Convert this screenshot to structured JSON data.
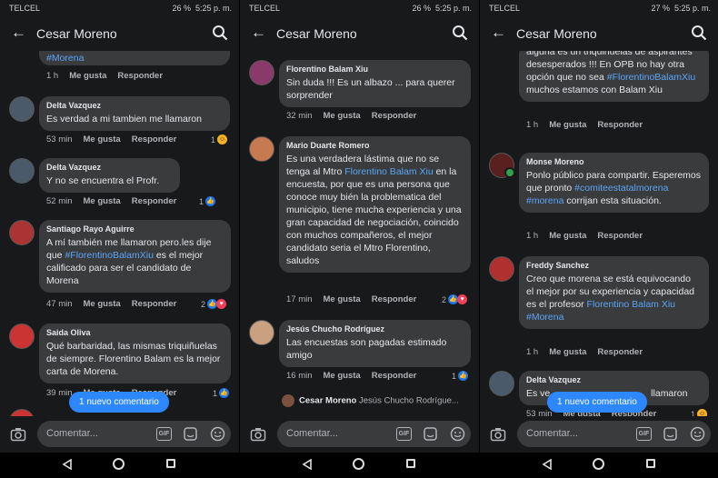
{
  "status_bar": [
    {
      "carrier": "TELCEL",
      "signal": "4G",
      "battery": "26 %",
      "time": "5:25 p. m."
    },
    {
      "carrier": "TELCEL",
      "signal": "4G",
      "battery": "26 %",
      "time": "5:25 p. m."
    },
    {
      "carrier": "TELCEL",
      "signal": "4G",
      "battery": "27 %",
      "time": "5:25 p. m."
    }
  ],
  "header": {
    "title": "Cesar Moreno",
    "back_icon": "arrow-left-icon",
    "search_icon": "search-icon"
  },
  "actions": {
    "like": "Me gusta",
    "reply": "Responder"
  },
  "panels": [
    {
      "comments": [
        {
          "author": "",
          "text": "",
          "link": "#Morena",
          "time": "1 h",
          "reactions": ""
        },
        {
          "author": "Delta Vazquez",
          "text": "Es verdad a mi tambien me llamaron",
          "time": "53 min",
          "reactions": "1"
        },
        {
          "author": "Delta Vazquez",
          "text": "Y no se encuentra el Profr.",
          "time": "52 min",
          "reactions": "1"
        },
        {
          "author": "Santiago Rayo Aguirre",
          "text_a": "A mí también me llamaron pero.les dije que ",
          "link": "#FlorentinoBalamXiu",
          "text_b": " es el mejor calificado para ser el candidato de Morena",
          "time": "47 min",
          "reactions": "2"
        },
        {
          "author": "Saida Oliva",
          "text": "Qué barbaridad, las mismas triquiñuelas de siempre. Florentino Balam es la mejor carta de Morena.",
          "time": "39 min",
          "reactions": "1"
        }
      ]
    },
    {
      "comments": [
        {
          "author": "Florentino Balam Xiu",
          "text": "Sin duda !!! Es un albazo ... para querer sorprender",
          "time": "32 min",
          "reactions": ""
        },
        {
          "author": "Mario Duarte Romero",
          "text_a": "Es una verdadera lástima que no se tenga al Mtro ",
          "link": "Florentino Balam Xiu",
          "text_b": " en la encuesta, por que es una persona que conoce muy bién la problematica del municipio, tiene mucha experiencia y una gran capacidad de negociación, coincido con muchos compañeros, el mejor candidato seria el Mtro Florentino, saludos",
          "time": "17 min",
          "reactions": "2"
        },
        {
          "author": "Jesús Chucho Rodríguez",
          "text": "Las encuestas son pagadas estimado amigo",
          "time": "16 min",
          "reactions": "1"
        }
      ],
      "reply_preview": {
        "author": "Cesar Moreno",
        "text": "Jesús Chucho Rodrígue..."
      }
    },
    {
      "comments": [
        {
          "author": "",
          "text_a": "alguna es un triquiñuelas de aspirantes desesperados !!! En OPB no hay otra opción que no sea ",
          "link": "#FlorentinoBalamXiu",
          "text_b": "  muchos estamos con Balam Xiu",
          "time": "1 h",
          "reactions": ""
        },
        {
          "author": "Monse Moreno",
          "text_a": "Ponlo público para compartir. Esperemos que pronto ",
          "link": "#comiteestatalmorena",
          "link2": "#morena",
          "text_b": " corrijan esta situación.",
          "time": "1 h",
          "reactions": ""
        },
        {
          "author": "Freddy Sanchez",
          "text_a": "Creo que morena se está equivocando el mejor por su experiencia y capacidad es el profesor ",
          "link": "Florentino Balam Xiu",
          "link2": "#Morena",
          "time": "1 h",
          "reactions": ""
        },
        {
          "author": "Delta Vazquez",
          "text_a": "Es ve",
          "text_b": " llamaron",
          "time": "53 min",
          "reactions": "1"
        }
      ]
    }
  ],
  "new_comment_pill": "1 nuevo comentario",
  "composer": {
    "placeholder": "Comentar...",
    "gif_label": "GIF"
  },
  "colors": {
    "background": "#18191a",
    "bubble": "#3a3b3c",
    "link": "#5aa5f7",
    "accent": "#2d88ff"
  }
}
